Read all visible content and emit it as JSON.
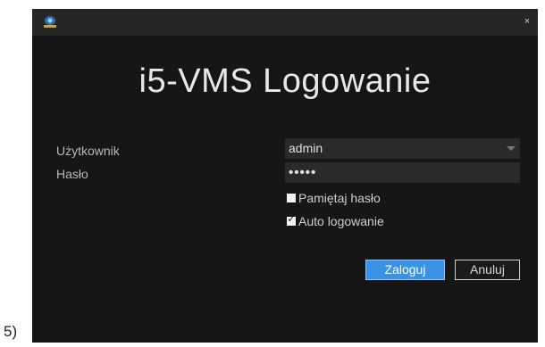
{
  "caption_prefix": "5)",
  "dialog": {
    "heading": "i5-VMS Logowanie",
    "close_glyph": "×",
    "app_icon": "camera-logo-icon",
    "username_label": "Użytkownik",
    "username_value": "admin",
    "password_label": "Hasło",
    "password_value": "•••••",
    "remember_label": "Pamiętaj hasło",
    "remember_checked": false,
    "autologin_label": "Auto logowanie",
    "autologin_checked": true,
    "login_button": "Zaloguj",
    "cancel_button": "Anuluj",
    "colors": {
      "background": "#161616",
      "titlebar": "#262626",
      "field": "#2a2a2a",
      "accent": "#3a92e6"
    }
  }
}
